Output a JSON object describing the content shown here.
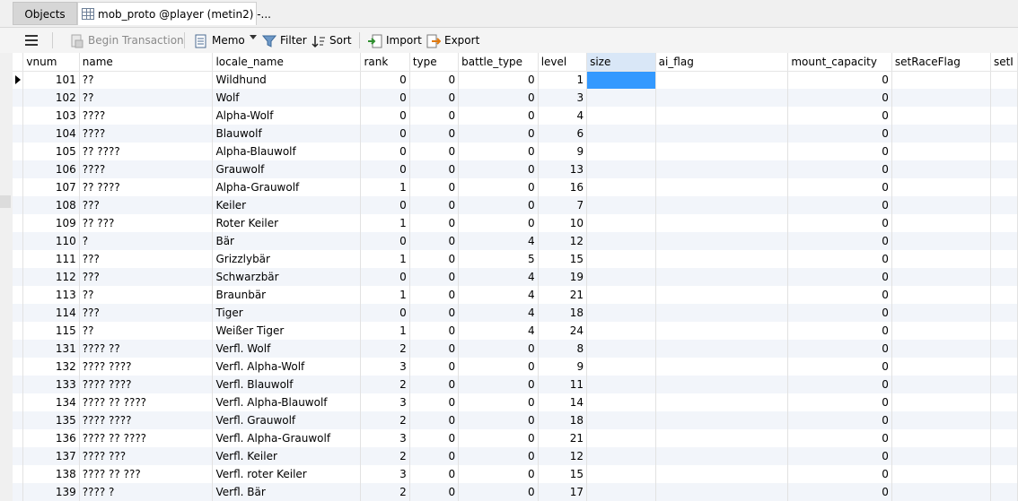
{
  "tabs": {
    "objects_label": "Objects",
    "table_label": "mob_proto @player (metin2) -..."
  },
  "toolbar": {
    "menu_icon": "hamburger-icon",
    "begin_transaction": "Begin Transaction",
    "memo": "Memo",
    "filter": "Filter",
    "sort": "Sort",
    "import": "Import",
    "export": "Export"
  },
  "columns": [
    "vnum",
    "name",
    "locale_name",
    "rank",
    "type",
    "battle_type",
    "level",
    "size",
    "ai_flag",
    "mount_capacity",
    "setRaceFlag",
    "setI"
  ],
  "rows": [
    {
      "vnum": "101",
      "name": "??",
      "locale_name": "Wildhund",
      "rank": "0",
      "type": "0",
      "battle_type": "0",
      "level": "1",
      "mount_capacity": "0"
    },
    {
      "vnum": "102",
      "name": "??",
      "locale_name": "Wolf",
      "rank": "0",
      "type": "0",
      "battle_type": "0",
      "level": "3",
      "mount_capacity": "0"
    },
    {
      "vnum": "103",
      "name": "????",
      "locale_name": "Alpha-Wolf",
      "rank": "0",
      "type": "0",
      "battle_type": "0",
      "level": "4",
      "mount_capacity": "0"
    },
    {
      "vnum": "104",
      "name": "????",
      "locale_name": "Blauwolf",
      "rank": "0",
      "type": "0",
      "battle_type": "0",
      "level": "6",
      "mount_capacity": "0"
    },
    {
      "vnum": "105",
      "name": "?? ????",
      "locale_name": "Alpha-Blauwolf",
      "rank": "0",
      "type": "0",
      "battle_type": "0",
      "level": "9",
      "mount_capacity": "0"
    },
    {
      "vnum": "106",
      "name": "????",
      "locale_name": "Grauwolf",
      "rank": "0",
      "type": "0",
      "battle_type": "0",
      "level": "13",
      "mount_capacity": "0"
    },
    {
      "vnum": "107",
      "name": "?? ????",
      "locale_name": "Alpha-Grauwolf",
      "rank": "1",
      "type": "0",
      "battle_type": "0",
      "level": "16",
      "mount_capacity": "0"
    },
    {
      "vnum": "108",
      "name": "???",
      "locale_name": "Keiler",
      "rank": "0",
      "type": "0",
      "battle_type": "0",
      "level": "7",
      "mount_capacity": "0"
    },
    {
      "vnum": "109",
      "name": "?? ???",
      "locale_name": "Roter Keiler",
      "rank": "1",
      "type": "0",
      "battle_type": "0",
      "level": "10",
      "mount_capacity": "0"
    },
    {
      "vnum": "110",
      "name": "?",
      "locale_name": "Bär",
      "rank": "0",
      "type": "0",
      "battle_type": "4",
      "level": "12",
      "mount_capacity": "0"
    },
    {
      "vnum": "111",
      "name": "???",
      "locale_name": "Grizzlybär",
      "rank": "1",
      "type": "0",
      "battle_type": "5",
      "level": "15",
      "mount_capacity": "0"
    },
    {
      "vnum": "112",
      "name": "???",
      "locale_name": "Schwarzbär",
      "rank": "0",
      "type": "0",
      "battle_type": "4",
      "level": "19",
      "mount_capacity": "0"
    },
    {
      "vnum": "113",
      "name": "??",
      "locale_name": "Braunbär",
      "rank": "1",
      "type": "0",
      "battle_type": "4",
      "level": "21",
      "mount_capacity": "0"
    },
    {
      "vnum": "114",
      "name": "???",
      "locale_name": "Tiger",
      "rank": "0",
      "type": "0",
      "battle_type": "4",
      "level": "18",
      "mount_capacity": "0"
    },
    {
      "vnum": "115",
      "name": "??",
      "locale_name": "Weißer Tiger",
      "rank": "1",
      "type": "0",
      "battle_type": "4",
      "level": "24",
      "mount_capacity": "0"
    },
    {
      "vnum": "131",
      "name": "???? ??",
      "locale_name": "Verfl. Wolf",
      "rank": "2",
      "type": "0",
      "battle_type": "0",
      "level": "8",
      "mount_capacity": "0"
    },
    {
      "vnum": "132",
      "name": "???? ????",
      "locale_name": "Verfl. Alpha-Wolf",
      "rank": "3",
      "type": "0",
      "battle_type": "0",
      "level": "9",
      "mount_capacity": "0"
    },
    {
      "vnum": "133",
      "name": "???? ????",
      "locale_name": "Verfl. Blauwolf",
      "rank": "2",
      "type": "0",
      "battle_type": "0",
      "level": "11",
      "mount_capacity": "0"
    },
    {
      "vnum": "134",
      "name": "???? ?? ????",
      "locale_name": "Verfl. Alpha-Blauwolf",
      "rank": "3",
      "type": "0",
      "battle_type": "0",
      "level": "14",
      "mount_capacity": "0"
    },
    {
      "vnum": "135",
      "name": "???? ????",
      "locale_name": "Verfl. Grauwolf",
      "rank": "2",
      "type": "0",
      "battle_type": "0",
      "level": "18",
      "mount_capacity": "0"
    },
    {
      "vnum": "136",
      "name": "???? ?? ????",
      "locale_name": "Verfl. Alpha-Grauwolf",
      "rank": "3",
      "type": "0",
      "battle_type": "0",
      "level": "21",
      "mount_capacity": "0"
    },
    {
      "vnum": "137",
      "name": "???? ???",
      "locale_name": "Verfl. Keiler",
      "rank": "2",
      "type": "0",
      "battle_type": "0",
      "level": "12",
      "mount_capacity": "0"
    },
    {
      "vnum": "138",
      "name": "???? ?? ???",
      "locale_name": "Verfl. roter Keiler",
      "rank": "3",
      "type": "0",
      "battle_type": "0",
      "level": "15",
      "mount_capacity": "0"
    },
    {
      "vnum": "139",
      "name": "???? ?",
      "locale_name": "Verfl. Bär",
      "rank": "2",
      "type": "0",
      "battle_type": "0",
      "level": "17",
      "mount_capacity": "0"
    }
  ],
  "selection": {
    "row_index": 0,
    "column": "size"
  },
  "colors": {
    "selection": "#3399ff",
    "alt_row": "#f2f5fa"
  }
}
